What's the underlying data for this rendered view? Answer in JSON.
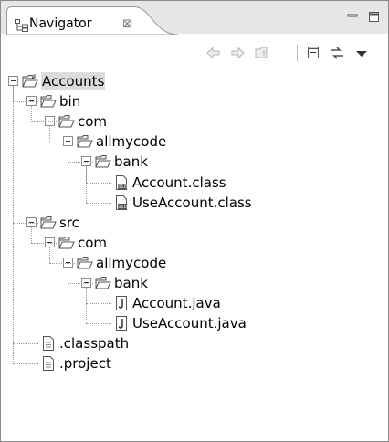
{
  "view": {
    "title": "Navigator",
    "close_glyph": "⊠",
    "tab_icon": "navigator-tree-icon"
  },
  "toolbar": {
    "buttons": [
      "back-arrow-icon",
      "forward-arrow-icon",
      "up-folder-icon",
      "collapse-all-icon",
      "link-with-editor-icon",
      "view-menu-icon"
    ]
  },
  "window_controls": [
    "minimize-icon",
    "maximize-icon"
  ],
  "tree": [
    {
      "label": "Accounts",
      "depth": 0,
      "icon": "project-icon",
      "expanded": true,
      "selected": true
    },
    {
      "label": "bin",
      "depth": 1,
      "icon": "folder-open-icon",
      "expanded": true
    },
    {
      "label": "com",
      "depth": 2,
      "icon": "folder-open-icon",
      "expanded": true
    },
    {
      "label": "allmycode",
      "depth": 3,
      "icon": "folder-open-icon",
      "expanded": true
    },
    {
      "label": "bank",
      "depth": 4,
      "icon": "folder-open-icon",
      "expanded": true
    },
    {
      "label": "Account.class",
      "depth": 5,
      "icon": "class-file-icon"
    },
    {
      "label": "UseAccount.class",
      "depth": 5,
      "icon": "class-file-icon"
    },
    {
      "label": "src",
      "depth": 1,
      "icon": "folder-open-icon",
      "expanded": true
    },
    {
      "label": "com",
      "depth": 2,
      "icon": "folder-open-icon",
      "expanded": true
    },
    {
      "label": "allmycode",
      "depth": 3,
      "icon": "folder-open-icon",
      "expanded": true
    },
    {
      "label": "bank",
      "depth": 4,
      "icon": "folder-open-icon",
      "expanded": true
    },
    {
      "label": "Account.java",
      "depth": 5,
      "icon": "java-file-icon"
    },
    {
      "label": "UseAccount.java",
      "depth": 5,
      "icon": "java-file-icon"
    },
    {
      "label": ".classpath",
      "depth": 1,
      "icon": "text-file-icon"
    },
    {
      "label": ".project",
      "depth": 1,
      "icon": "text-file-icon"
    }
  ]
}
